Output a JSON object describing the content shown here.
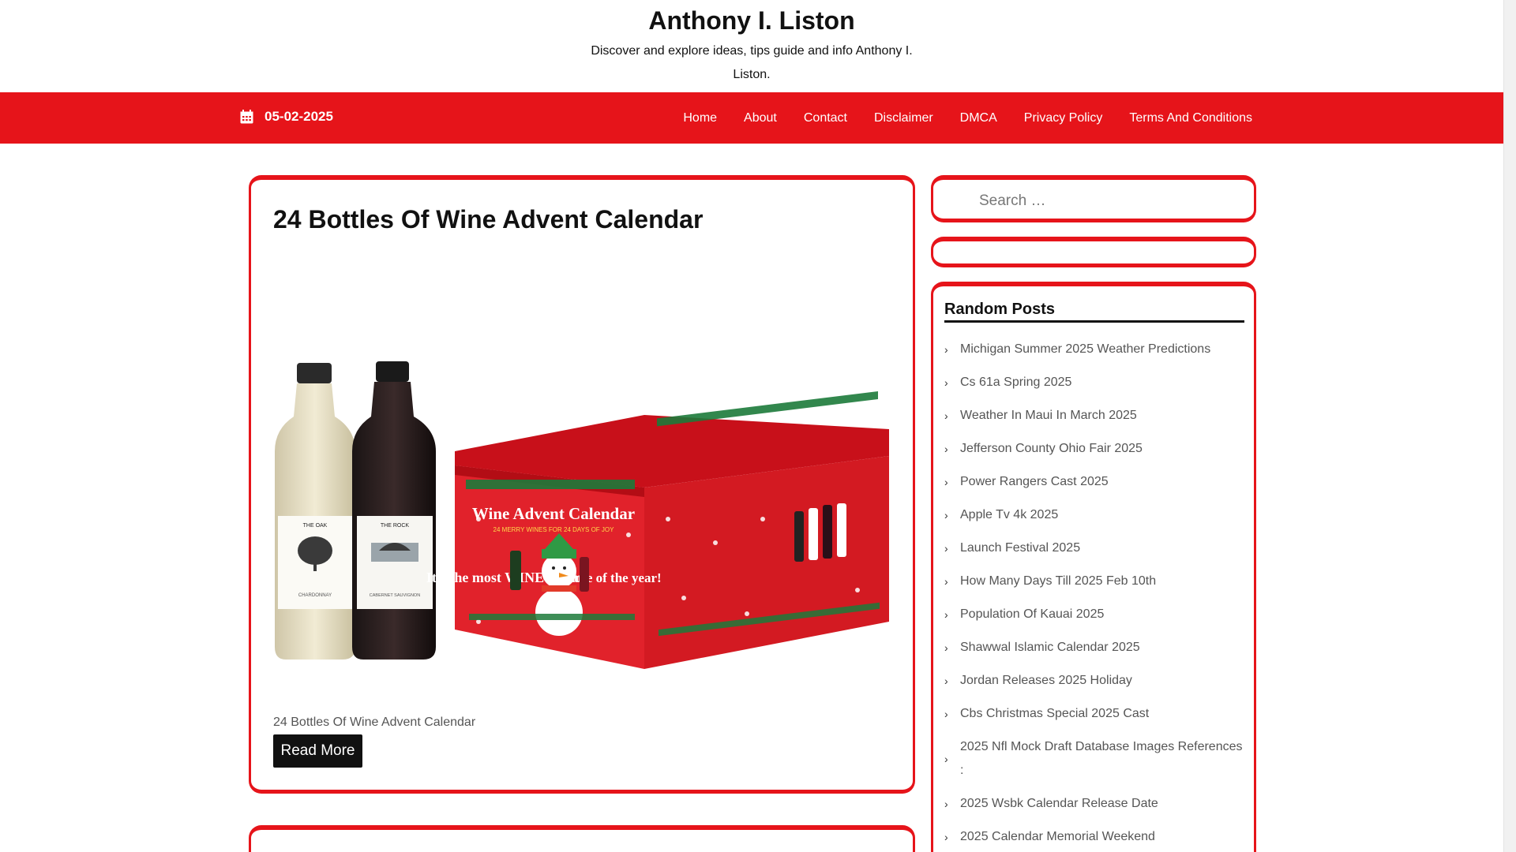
{
  "header": {
    "site_title": "Anthony I. Liston",
    "site_description": "Discover and explore ideas, tips guide and info Anthony I. Liston."
  },
  "navbar": {
    "date": "05-02-2025",
    "menu": [
      "Home",
      "About",
      "Contact",
      "Disclaimer",
      "DMCA",
      "Privacy Policy",
      "Terms And Conditions"
    ]
  },
  "post": {
    "title": "24 Bottles Of Wine Advent Calendar",
    "image_alt": "24 Bottles Of Wine Advent Calendar",
    "image_text": {
      "box_title": "Wine Advent Calendar",
      "box_subtitle": "24 MERRY WINES FOR 24 DAYS OF JOY",
      "slogan_left": "It's the most WINE-derful",
      "slogan_right": "time of the year!",
      "bottle_1": "THE OAK",
      "bottle_1_type": "CHARDONNAY",
      "bottle_2": "THE ROCK",
      "bottle_2_type": "CABERNET SAUVIGNON"
    },
    "caption": "24 Bottles Of Wine Advent Calendar",
    "read_more": "Read More"
  },
  "sidebar": {
    "search_placeholder": "Search …",
    "random_posts_title": "Random Posts",
    "random_posts": [
      "Michigan Summer 2025 Weather Predictions",
      "Cs 61a Spring 2025",
      "Weather In Maui In March 2025",
      "Jefferson County Ohio Fair 2025",
      "Power Rangers Cast 2025",
      "Apple Tv 4k 2025",
      "Launch Festival 2025",
      "How Many Days Till 2025 Feb 10th",
      "Population Of Kauai 2025",
      "Shawwal Islamic Calendar 2025",
      "Jordan Releases 2025 Holiday",
      "Cbs Christmas Special 2025 Cast",
      "2025 Nfl Mock Draft Database Images References :",
      "2025 Wsbk Calendar Release Date",
      "2025 Calendar Memorial Weekend"
    ]
  },
  "colors": {
    "accent": "#e6141a",
    "button": "#111111"
  },
  "icons": {
    "date": "calendar-icon",
    "list_bullet": "chevron-right-icon"
  }
}
